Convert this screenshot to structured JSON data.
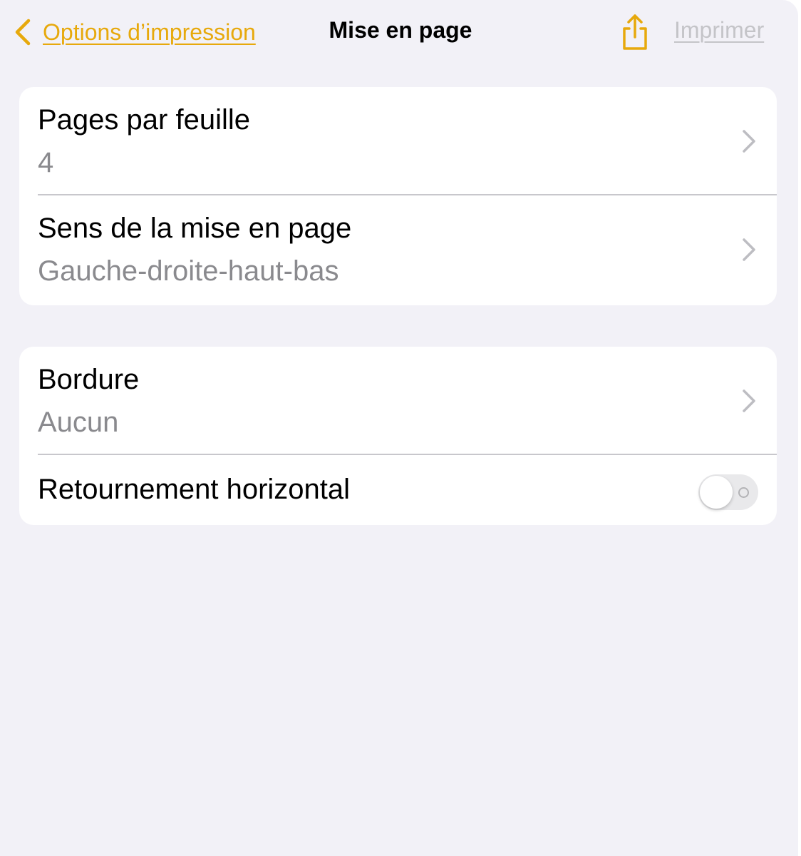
{
  "nav": {
    "back_label": "Options d’impression",
    "title": "Mise en page",
    "share_icon": "share-icon",
    "print_label": "Imprimer"
  },
  "groups": [
    {
      "rows": [
        {
          "label": "Pages par feuille",
          "value": "4",
          "icon": "chevron-right-icon"
        },
        {
          "label": "Sens de la mise en page",
          "value": "Gauche-droite-haut-bas",
          "icon": "chevron-right-icon"
        }
      ]
    },
    {
      "rows": [
        {
          "label": "Bordure",
          "value": "Aucun",
          "icon": "chevron-right-icon"
        },
        {
          "label": "Retournement horizontal",
          "toggle_on": false
        }
      ]
    }
  ],
  "colors": {
    "accent": "#e7a90c",
    "background": "#f2f1f7",
    "disabled": "#c4c4c8",
    "secondary_text": "#8a8a8e"
  }
}
